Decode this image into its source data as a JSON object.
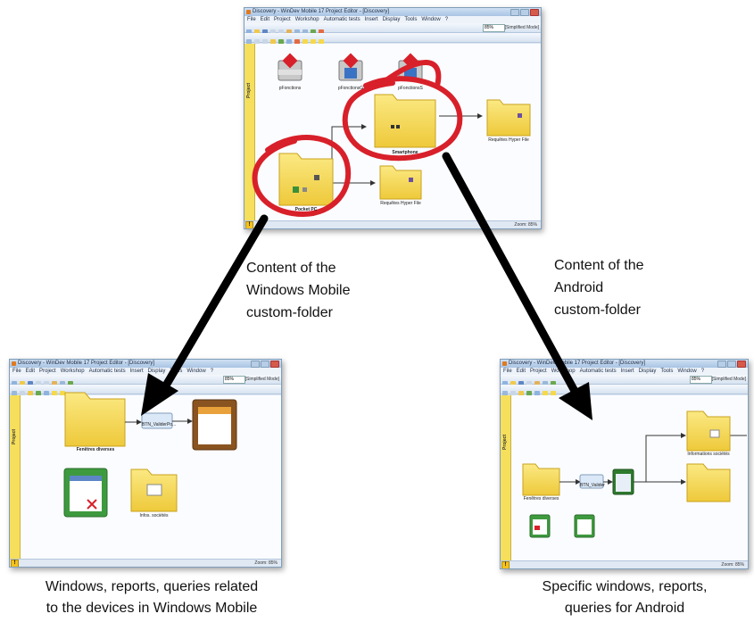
{
  "top_window": {
    "title": "Discovery - WinDev Mobile 17 Project Editor - [Discovery]",
    "menu": [
      "File",
      "Edit",
      "Project",
      "Workshop",
      "Automatic tests",
      "Insert",
      "Display",
      "Tools",
      "Window",
      "?"
    ],
    "zoom_dropdown": "85%",
    "toolbar_badge": "[Simplified Mode]",
    "side_tab": "Project",
    "items": {
      "class1": "pFonctions",
      "class2": "pFonctionsG",
      "class3": "pFonctionsS",
      "folder_smartphone": "Smartphone",
      "folder_pocket": "Pocket PC",
      "query_top": "Requêtes Hyper File",
      "query_bottom": "Requêtes Hyper File"
    },
    "status_zoom": "Zoom: 85%"
  },
  "bottom_left_window": {
    "title": "Discovery - WinDev Mobile 17 Project Editor - [Discovery]",
    "menu": [
      "File",
      "Edit",
      "Project",
      "Workshop",
      "Automatic tests",
      "Insert",
      "Display",
      "Tools",
      "Window",
      "?"
    ],
    "zoom_dropdown": "85%",
    "toolbar_badge": "[Simplified Mode]",
    "side_tab": "Project",
    "items": {
      "folder1": "Fenêtres diverses",
      "button": "BTN_ValiderPo...",
      "folder2": "Infos. sociétés"
    },
    "status_zoom": "Zoom: 85%"
  },
  "bottom_right_window": {
    "title": "Discovery - WinDev Mobile 17 Project Editor - [Discovery]",
    "menu": [
      "File",
      "Edit",
      "Project",
      "Workshop",
      "Automatic tests",
      "Insert",
      "Display",
      "Tools",
      "Window",
      "?"
    ],
    "zoom_dropdown": "85%",
    "toolbar_badge": "[Simplified Mode]",
    "side_tab": "Project",
    "items": {
      "folder1": "Fenêtres diverses",
      "button": "BTN_Valider",
      "folder_top": "Informations sociétés"
    },
    "status_zoom": "Zoom: 85%"
  },
  "callouts": {
    "left": [
      "Content of the",
      "Windows Mobile",
      "custom-folder"
    ],
    "right": [
      "Content of the",
      "Android",
      "custom-folder"
    ]
  },
  "captions": {
    "left": [
      "Windows, reports, queries related",
      "to the devices in Windows Mobile"
    ],
    "right": [
      "Specific windows, reports,",
      "queries for Android"
    ]
  },
  "colors": {
    "highlight_red": "#d8202a",
    "arrow_black": "#000000",
    "folder_yellow": "#f5d94a",
    "side_tab_yellow": "#f5df5c"
  }
}
